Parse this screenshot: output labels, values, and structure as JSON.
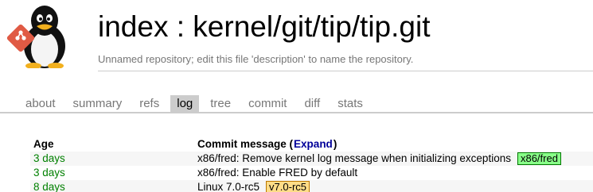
{
  "header": {
    "title": "index : kernel/git/tip/tip.git",
    "description": "Unnamed repository; edit this file 'description' to name the repository."
  },
  "colors": {
    "branch_decoration": "#88ff88",
    "tag_decoration": "#ffdd88",
    "age_recent": "#008000",
    "active_tab": "#cccccc",
    "logo_badge": "#e05a44"
  },
  "tabs": [
    {
      "label": "about"
    },
    {
      "label": "summary"
    },
    {
      "label": "refs"
    },
    {
      "label": "log",
      "active": true
    },
    {
      "label": "tree"
    },
    {
      "label": "commit"
    },
    {
      "label": "diff"
    },
    {
      "label": "stats"
    }
  ],
  "log": {
    "columns": {
      "age": "Age",
      "message_prefix": "Commit message (",
      "expand": "Expand",
      "message_suffix": ")"
    },
    "rows": [
      {
        "age": "3 days",
        "message": "x86/fred: Remove kernel log message when initializing exceptions",
        "decoration": "x86/fred",
        "decoration_type": "branch"
      },
      {
        "age": "3 days",
        "message": "x86/fred: Enable FRED by default",
        "decoration": "",
        "decoration_type": ""
      },
      {
        "age": "8 days",
        "message": "Linux 7.0-rc5",
        "decoration": "v7.0-rc5",
        "decoration_type": "tag"
      }
    ]
  }
}
